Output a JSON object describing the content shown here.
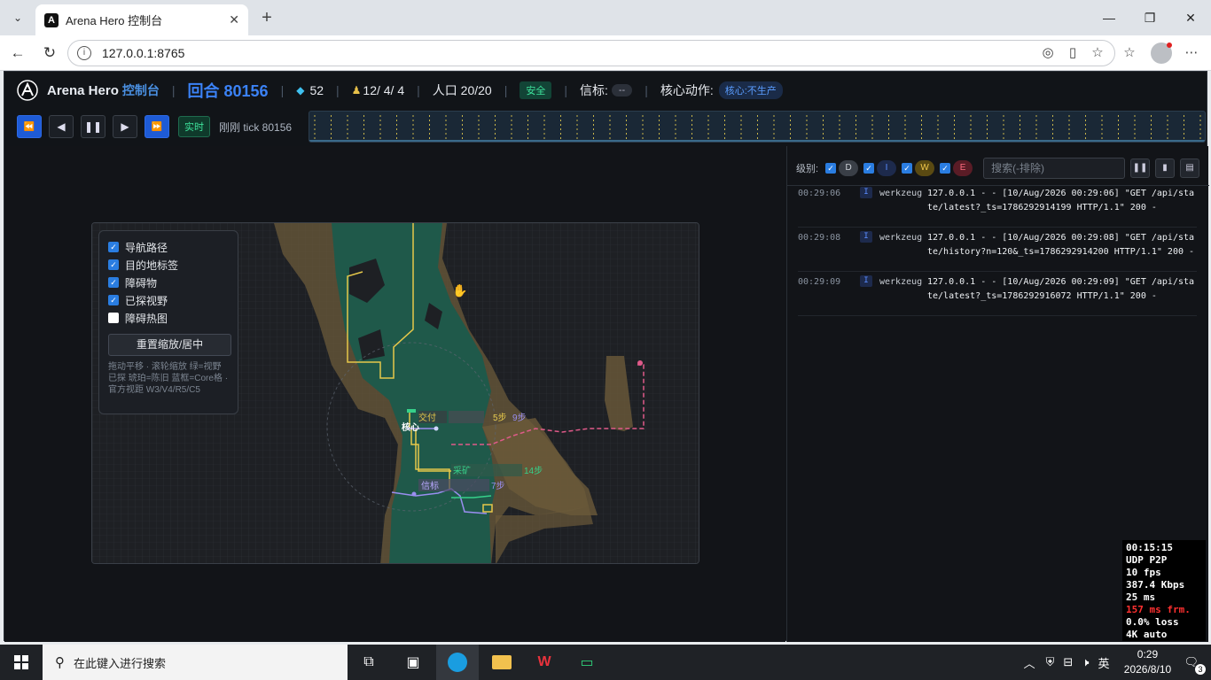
{
  "browser": {
    "tab_title": "Arena Hero 控制台",
    "url": "127.0.0.1:8765"
  },
  "header": {
    "brand": "Arena Hero",
    "brand_sub": "控制台",
    "round": "回合 80156",
    "gems": "52",
    "units": "12/ 4/ 4",
    "population": "人口 20/20",
    "status": "安全",
    "beacon_label": "信标:",
    "beacon_value": "--",
    "core_action_label": "核心动作:",
    "core_action_value": "核心:不生产"
  },
  "controls": {
    "live": "实时",
    "tick": "刚刚 tick 80156"
  },
  "layers": {
    "items": [
      {
        "label": "导航路径",
        "checked": true
      },
      {
        "label": "目的地标签",
        "checked": true
      },
      {
        "label": "障碍物",
        "checked": true
      },
      {
        "label": "已探视野",
        "checked": true
      },
      {
        "label": "障碍热图",
        "checked": false
      }
    ],
    "reset": "重置缩放/居中",
    "help": "拖动平移 · 滚轮缩放 绿=视野已探 琥珀=陈旧 蓝框=Core格 · 官方视距 W3/V4/R5/C5"
  },
  "map_labels": {
    "deliver": "交付",
    "deliver_steps1": "5步",
    "deliver_steps2": "9步",
    "core": "核心",
    "mine": "采矿",
    "mine_steps": "14步",
    "beacon": "信标",
    "beacon_steps": "7步"
  },
  "log": {
    "level_label": "级别:",
    "levels": [
      "D",
      "I",
      "W",
      "E"
    ],
    "search_placeholder": "搜索(-排除)",
    "rows": [
      {
        "time": "00:29:06",
        "level": "I",
        "source": "werkzeug",
        "message": "127.0.0.1 - - [10/Aug/2026 00:29:06] \"GET /api/state/latest?_ts=1786292914199 HTTP/1.1\" 200 -"
      },
      {
        "time": "00:29:08",
        "level": "I",
        "source": "werkzeug",
        "message": "127.0.0.1 - - [10/Aug/2026 00:29:08] \"GET /api/state/history?n=120&_ts=1786292914200 HTTP/1.1\" 200 -"
      },
      {
        "time": "00:29:09",
        "level": "I",
        "source": "werkzeug",
        "message": "127.0.0.1 - - [10/Aug/2026 00:29:09] \"GET /api/state/latest?_ts=1786292916072 HTTP/1.1\" 200 -"
      }
    ]
  },
  "stream_stats": {
    "uptime": "00:15:15",
    "proto": "UDP P2P",
    "fps": "10 fps",
    "bitrate": "387.4 Kbps",
    "latency": "25 ms",
    "frame": "157 ms frm.",
    "loss": "0.0% loss",
    "quality": "4K auto"
  },
  "taskbar": {
    "search": "在此键入进行搜索",
    "ime": "英",
    "time": "0:29",
    "date": "2026/8/10",
    "notifications": "3"
  }
}
